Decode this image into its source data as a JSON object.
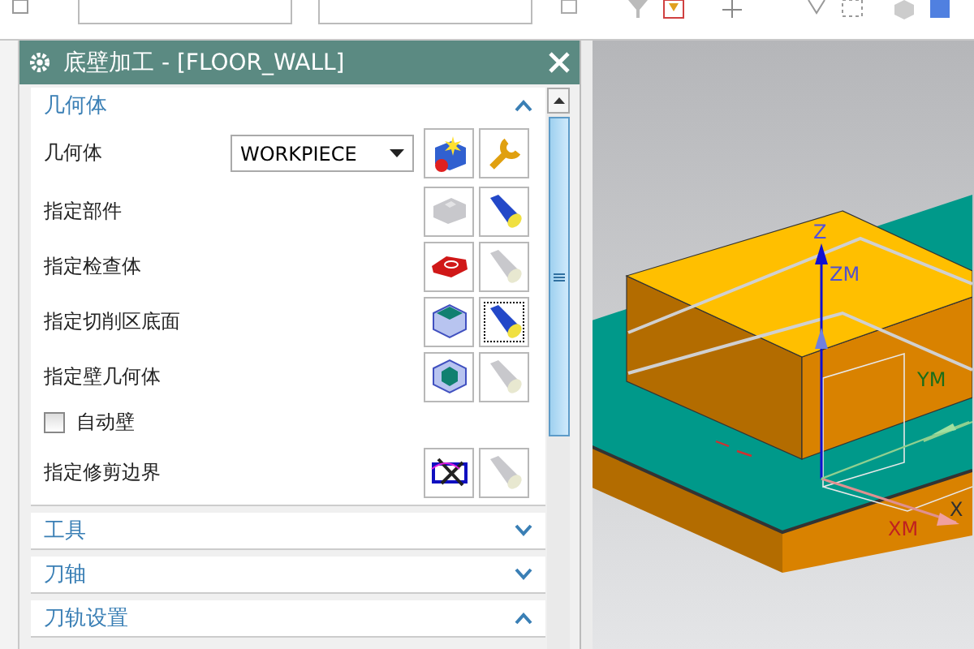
{
  "dialog": {
    "title": "底壁加工 - [FLOOR_WALL]",
    "sections": [
      {
        "title": "几何体",
        "expanded": true,
        "rows": [
          {
            "kind": "select",
            "label": "几何体",
            "value": "WORKPIECE"
          },
          {
            "kind": "part",
            "label": "指定部件",
            "display_enabled": true,
            "focused": false
          },
          {
            "kind": "check",
            "label": "指定检查体",
            "display_enabled": false,
            "focused": false
          },
          {
            "kind": "floor",
            "label": "指定切削区底面",
            "display_enabled": true,
            "focused": true
          },
          {
            "kind": "wall",
            "label": "指定壁几何体",
            "display_enabled": false,
            "focused": false
          },
          {
            "kind": "checkbox",
            "label": "自动壁",
            "checked": false
          },
          {
            "kind": "boundary",
            "label": "指定修剪边界",
            "display_enabled": false,
            "focused": false
          }
        ]
      },
      {
        "title": "工具",
        "expanded": false
      },
      {
        "title": "刀轴",
        "expanded": false
      },
      {
        "title": "刀轨设置",
        "expanded": true
      }
    ]
  },
  "viewport": {
    "axis_labels": [
      {
        "kind": "z",
        "text": "Z"
      },
      {
        "kind": "zm",
        "text": "ZM"
      },
      {
        "kind": "ym",
        "text": "YM"
      },
      {
        "kind": "xm",
        "text": "XM"
      },
      {
        "kind": "x",
        "text": "X"
      }
    ]
  }
}
